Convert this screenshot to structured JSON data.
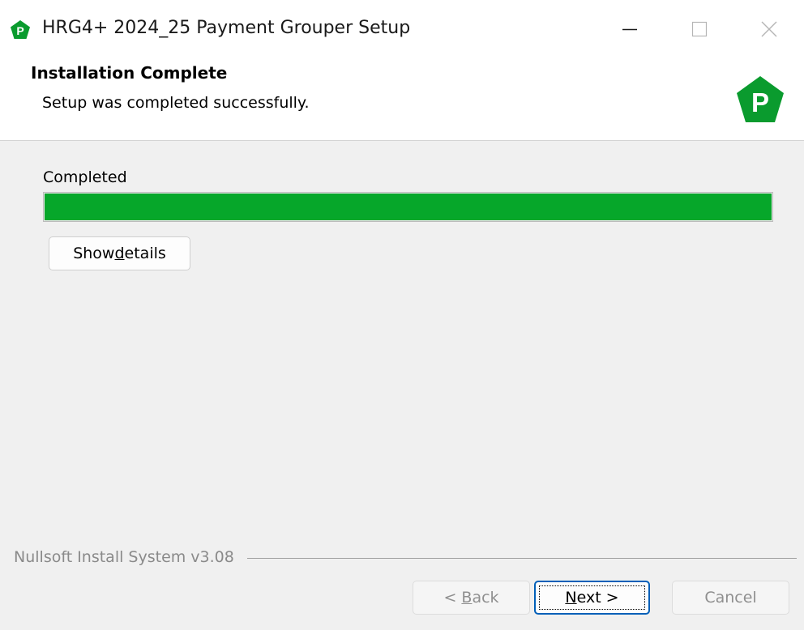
{
  "window": {
    "title": "HRG4+ 2024_25 Payment Grouper Setup",
    "icon": "green-pentagon-p-logo",
    "logo_letter": "P",
    "brand_color": "#0a9b2e",
    "controls": {
      "minimize_icon": "minimize-icon",
      "maximize_icon": "maximize-icon",
      "close_icon": "close-icon"
    }
  },
  "header": {
    "title": "Installation Complete",
    "subtitle": "Setup was completed successfully.",
    "logo_letter": "P"
  },
  "body": {
    "status_label": "Completed",
    "progress_percent": 100,
    "progress_color": "#06a72a",
    "details_button": {
      "prefix": "Show ",
      "mnemonic": "d",
      "suffix": "etails"
    }
  },
  "footer": {
    "branding": "Nullsoft Install System v3.08",
    "back_button": {
      "prefix": "< ",
      "mnemonic": "B",
      "suffix": "ack",
      "enabled": false
    },
    "next_button": {
      "prefix": "",
      "mnemonic": "N",
      "suffix": "ext >",
      "enabled": true,
      "focused": true
    },
    "cancel_button": {
      "label": "Cancel",
      "enabled": false
    }
  }
}
